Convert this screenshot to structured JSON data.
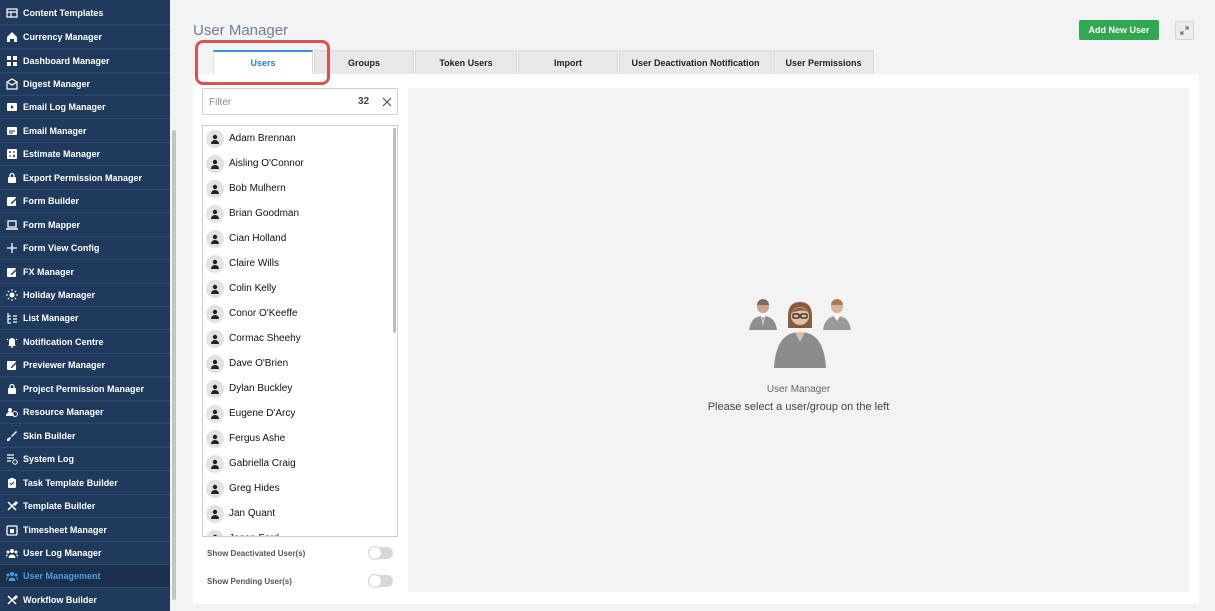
{
  "sidebar": {
    "items": [
      {
        "label": "Content Templates",
        "icon": "template-icon"
      },
      {
        "label": "Currency Manager",
        "icon": "home-icon"
      },
      {
        "label": "Dashboard Manager",
        "icon": "dashboard-icon"
      },
      {
        "label": "Digest Manager",
        "icon": "digest-icon"
      },
      {
        "label": "Email Log Manager",
        "icon": "email-log-icon"
      },
      {
        "label": "Email Manager",
        "icon": "email-icon"
      },
      {
        "label": "Estimate Manager",
        "icon": "estimate-icon"
      },
      {
        "label": "Export Permission Manager",
        "icon": "lock-icon"
      },
      {
        "label": "Form Builder",
        "icon": "edit-icon"
      },
      {
        "label": "Form Mapper",
        "icon": "laptop-icon"
      },
      {
        "label": "Form View Config",
        "icon": "plus-icon"
      },
      {
        "label": "FX Manager",
        "icon": "edit-icon"
      },
      {
        "label": "Holiday Manager",
        "icon": "sun-icon"
      },
      {
        "label": "List Manager",
        "icon": "list-icon"
      },
      {
        "label": "Notification Centre",
        "icon": "bell-icon"
      },
      {
        "label": "Previewer Manager",
        "icon": "edit-icon"
      },
      {
        "label": "Project Permission Manager",
        "icon": "lock-icon"
      },
      {
        "label": "Resource Manager",
        "icon": "resource-icon"
      },
      {
        "label": "Skin Builder",
        "icon": "brush-icon"
      },
      {
        "label": "System Log",
        "icon": "system-log-icon"
      },
      {
        "label": "Task Template Builder",
        "icon": "task-icon"
      },
      {
        "label": "Template Builder",
        "icon": "tools-icon"
      },
      {
        "label": "Timesheet Manager",
        "icon": "calendar-icon"
      },
      {
        "label": "User Log Manager",
        "icon": "users-icon"
      },
      {
        "label": "User Management",
        "icon": "users-icon"
      },
      {
        "label": "Workflow Builder",
        "icon": "tools-icon"
      }
    ],
    "active_index": 24
  },
  "header": {
    "title": "User Manager",
    "add_user_label": "Add New User"
  },
  "tabs": [
    {
      "label": "Users"
    },
    {
      "label": "Groups"
    },
    {
      "label": "Token Users"
    },
    {
      "label": "Import"
    },
    {
      "label": "User Deactivation Notification"
    },
    {
      "label": "User Permissions"
    }
  ],
  "filter": {
    "placeholder": "Filter",
    "count": "32"
  },
  "users": [
    "Adam Brennan",
    "Aisling O'Connor",
    "Bob Mulhern",
    "Brian Goodman",
    "Cian Holland",
    "Claire Wills",
    "Colin Kelly",
    "Conor O'Keeffe",
    "Cormac Sheehy",
    "Dave O'Brien",
    "Dylan Buckley",
    "Eugene D'Arcy",
    "Fergus Ashe",
    "Gabriella Craig",
    "Greg Hides",
    "Jan Quant",
    "Jason Ford"
  ],
  "toggles": {
    "deactivated_label": "Show Deactivated User(s)",
    "pending_label": "Show Pending User(s)"
  },
  "detail": {
    "title": "User Manager",
    "message": "Please select a user/group on the left"
  },
  "colors": {
    "sidebar_bg": "#1f3a5c",
    "active_text": "#4a9fe8",
    "add_button": "#2fa84f",
    "highlight": "#d9534f",
    "tab_active": "#2a7ddc"
  }
}
